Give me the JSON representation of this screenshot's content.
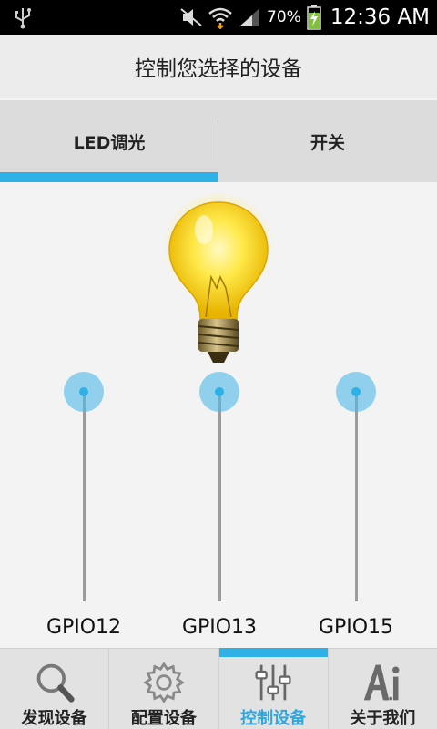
{
  "status_bar": {
    "battery_percent": "70%",
    "time": "12:36 AM",
    "icons": [
      "usb-icon",
      "mute-icon",
      "wifi-icon",
      "signal-icon",
      "battery-charging-icon"
    ]
  },
  "title": "控制您选择的设备",
  "tabs": [
    {
      "label": "LED调光",
      "selected": true
    },
    {
      "label": "开关",
      "selected": false
    }
  ],
  "sliders": [
    {
      "label": "GPIO12",
      "level": 1.0
    },
    {
      "label": "GPIO13",
      "level": 1.0
    },
    {
      "label": "GPIO15",
      "level": 1.0
    }
  ],
  "bottom_nav": [
    {
      "label": "发现设备",
      "icon": "magnifier-icon",
      "active": false
    },
    {
      "label": "配置设备",
      "icon": "gear-icon",
      "active": false
    },
    {
      "label": "控制设备",
      "icon": "sliders-icon",
      "active": true
    },
    {
      "label": "关于我们",
      "icon": "about-ai-icon",
      "active": false
    }
  ],
  "colors": {
    "accent": "#2eb1e6",
    "active_nav_text": "#2ea7e0",
    "background": "#f3f3f3"
  }
}
